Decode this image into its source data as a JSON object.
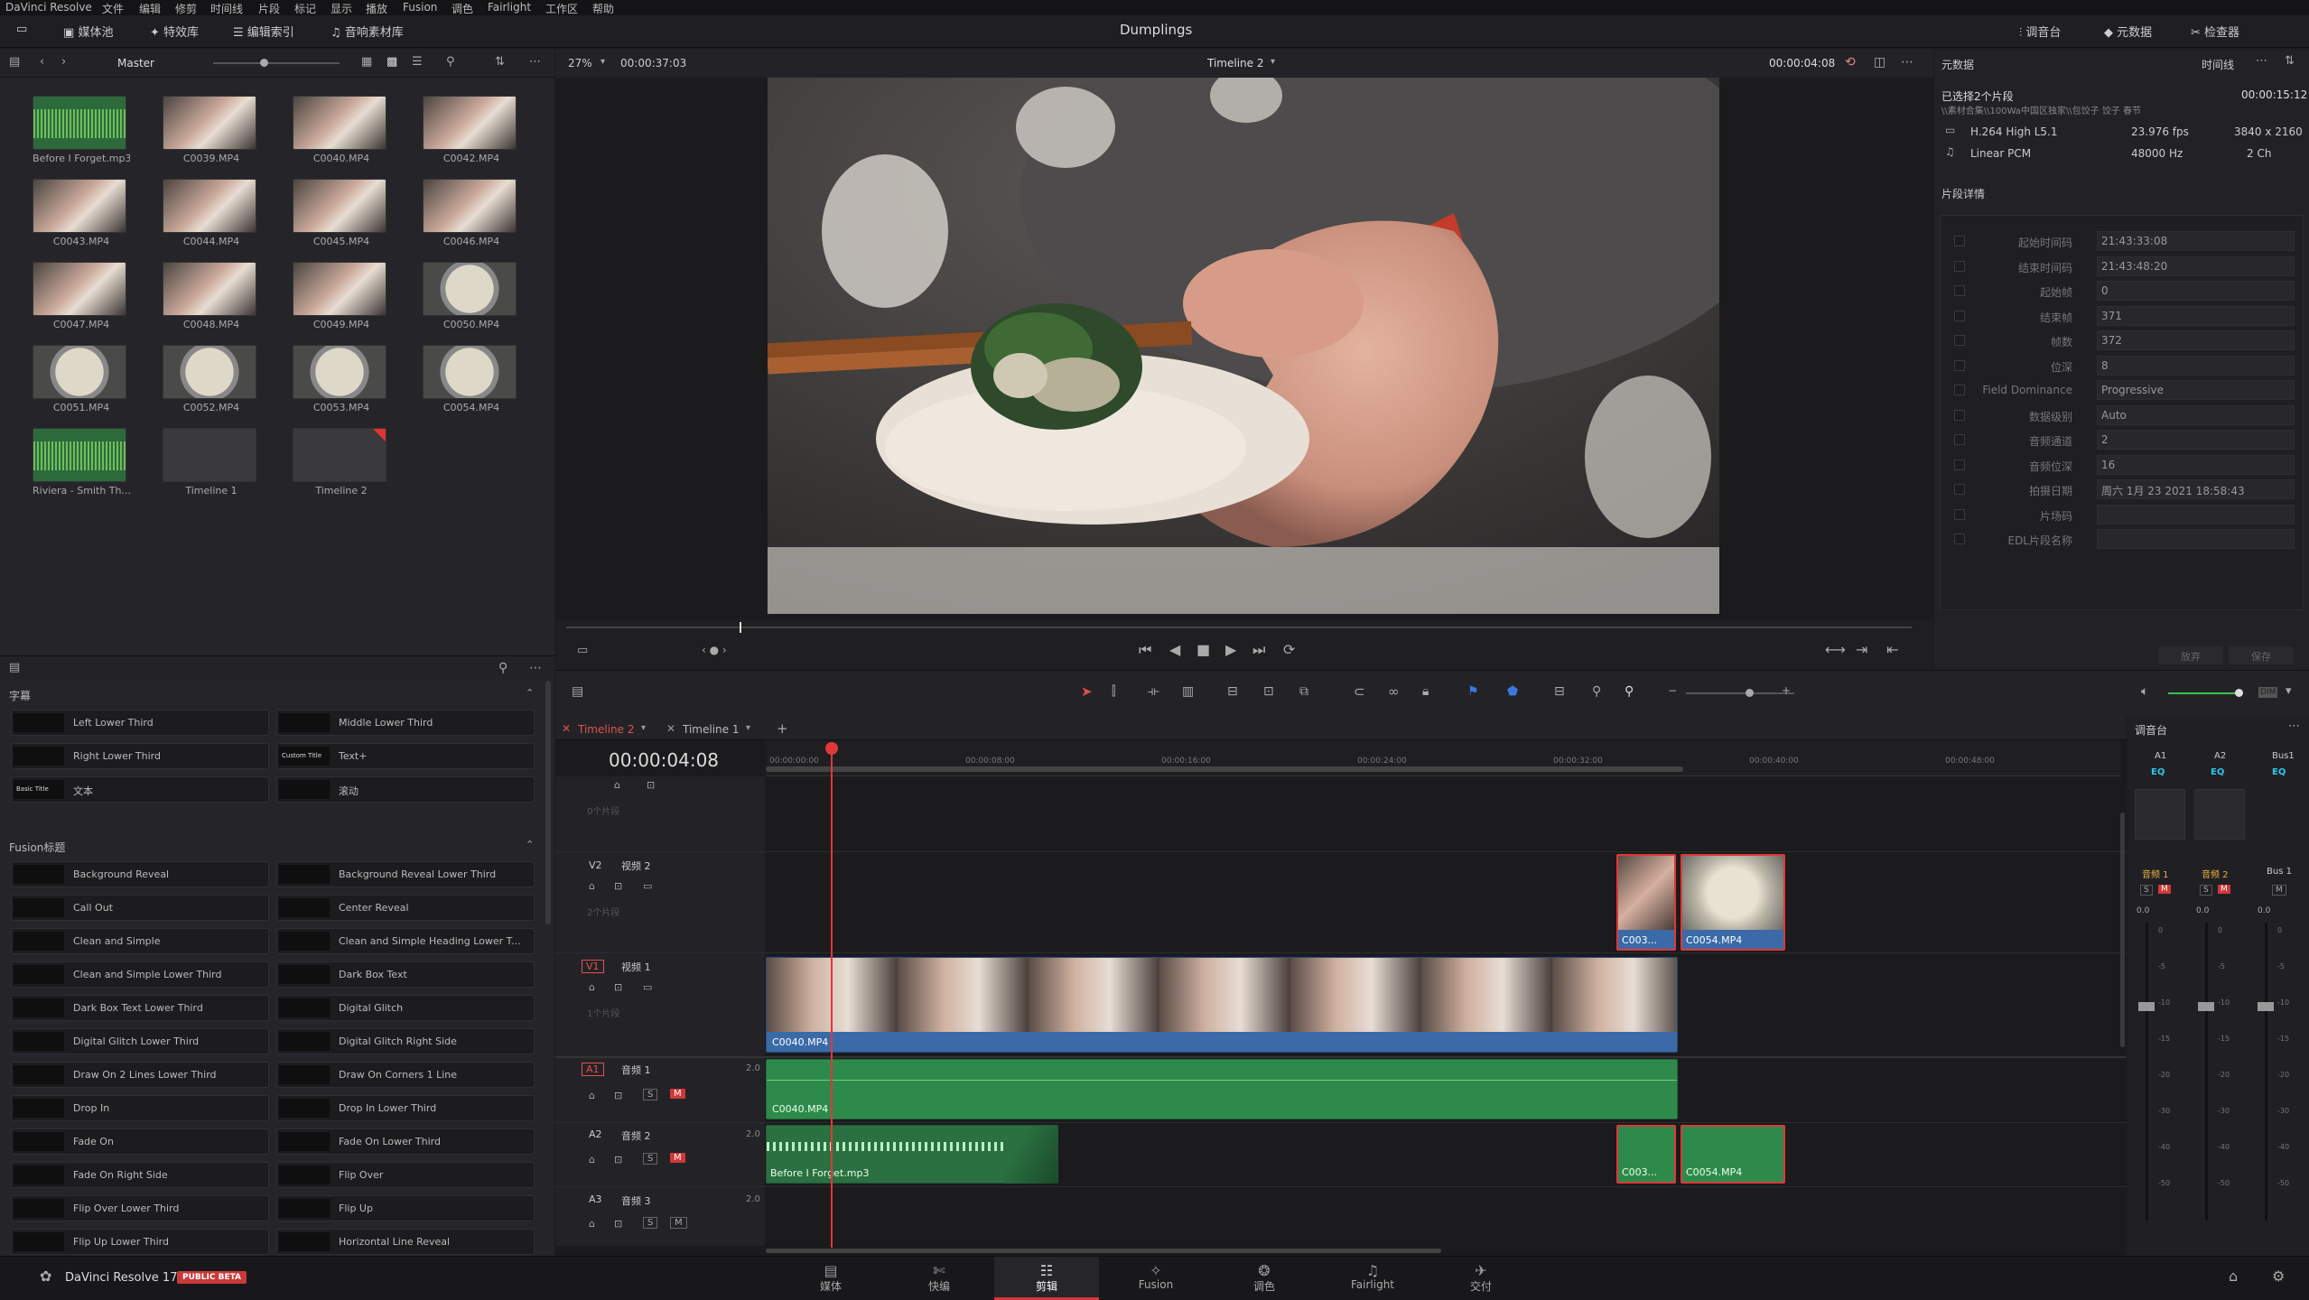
{
  "menubar": {
    "items": [
      "DaVinci Resolve",
      "文件",
      "编辑",
      "修剪",
      "时间线",
      "片段",
      "标记",
      "显示",
      "播放",
      "Fusion",
      "调色",
      "Fairlight",
      "工作区",
      "帮助"
    ]
  },
  "topbar": {
    "media_pool": "媒体池",
    "effects": "特效库",
    "edit_index": "编辑索引",
    "sound_library": "音响素材库",
    "project_title": "Dumplings",
    "mixer": "调音台",
    "metadata": "元数据",
    "inspector": "检查器"
  },
  "media_pool": {
    "bin": "Master",
    "clips": [
      {
        "name": "Before I Forget.mp3",
        "kind": "audio"
      },
      {
        "name": "C0039.MP4",
        "kind": "hand"
      },
      {
        "name": "C0040.MP4",
        "kind": "hand"
      },
      {
        "name": "C0042.MP4",
        "kind": "hand"
      },
      {
        "name": "C0043.MP4",
        "kind": "hand"
      },
      {
        "name": "C0044.MP4",
        "kind": "hand"
      },
      {
        "name": "C0045.MP4",
        "kind": "hand"
      },
      {
        "name": "C0046.MP4",
        "kind": "hand"
      },
      {
        "name": "C0047.MP4",
        "kind": "hand"
      },
      {
        "name": "C0048.MP4",
        "kind": "hand"
      },
      {
        "name": "C0049.MP4",
        "kind": "hand"
      },
      {
        "name": "C0050.MP4",
        "kind": "plate"
      },
      {
        "name": "C0051.MP4",
        "kind": "plate"
      },
      {
        "name": "C0052.MP4",
        "kind": "plate"
      },
      {
        "name": "C0053.MP4",
        "kind": "plate"
      },
      {
        "name": "C0054.MP4",
        "kind": "plate"
      },
      {
        "name": "Riviera - Smith Th...",
        "kind": "audio"
      },
      {
        "name": "Timeline 1",
        "kind": "tl"
      },
      {
        "name": "Timeline 2",
        "kind": "tl"
      }
    ]
  },
  "effects": {
    "subtitles_header": "字幕",
    "subtitles": [
      "Left Lower Third",
      "Middle Lower Third",
      "Right Lower Third",
      "Text+",
      "文本",
      "滚动"
    ],
    "subtitle_icons": [
      "",
      "",
      "",
      "Custom Title",
      "Basic Title",
      ""
    ],
    "fusion_header": "Fusion标题",
    "fusion": [
      "Background Reveal",
      "Background Reveal Lower Third",
      "Call Out",
      "Center Reveal",
      "Clean and Simple",
      "Clean and Simple Heading Lower T...",
      "Clean and Simple Lower Third",
      "Dark Box Text",
      "Dark Box Text Lower Third",
      "Digital Glitch",
      "Digital Glitch Lower Third",
      "Digital Glitch Right Side",
      "Draw On 2 Lines Lower Third",
      "Draw On Corners 1 Line",
      "Drop In",
      "Drop In Lower Third",
      "Fade On",
      "Fade On Lower Third",
      "Fade On Right Side",
      "Flip Over",
      "Flip Over Lower Third",
      "Flip Up",
      "Flip Up Lower Third",
      "Horizontal Line Reveal"
    ]
  },
  "viewer": {
    "zoom": "27%",
    "source_tc": "00:00:37:03",
    "timeline_name": "Timeline 2",
    "record_tc": "00:00:04:08",
    "playhead_fraction": 0.11
  },
  "metadata": {
    "title": "元数据",
    "right_label": "时间线",
    "selected": "已选择2个片段",
    "path": "\\\\素材合集\\\\100Wa中国区独家\\\\包饺子 饺子 春节",
    "duration": "00:00:15:12",
    "codec": "H.264 High L5.1",
    "fps": "23.976 fps",
    "resolution": "3840 x 2160",
    "audio_codec": "Linear PCM",
    "sample_rate": "48000 Hz",
    "channels": "2 Ch",
    "details_header": "片段详情",
    "fields": [
      {
        "label": "起始时间码",
        "value": "21:43:33:08"
      },
      {
        "label": "结束时间码",
        "value": "21:43:48:20"
      },
      {
        "label": "起始帧",
        "value": "0"
      },
      {
        "label": "结束帧",
        "value": "371"
      },
      {
        "label": "帧数",
        "value": "372"
      },
      {
        "label": "位深",
        "value": "8"
      },
      {
        "label": "Field Dominance",
        "value": "Progressive"
      },
      {
        "label": "数据级别",
        "value": "Auto"
      },
      {
        "label": "音频通道",
        "value": "2"
      },
      {
        "label": "音频位深",
        "value": "16"
      },
      {
        "label": "拍摄日期",
        "value": "周六 1月 23 2021 18:58:43"
      },
      {
        "label": "片场码",
        "value": ""
      },
      {
        "label": "EDL片段名称",
        "value": ""
      }
    ],
    "cancel": "放弃",
    "save": "保存"
  },
  "timeline": {
    "tab_active": "Timeline 2",
    "tab_other": "Timeline 1",
    "timecode": "00:00:04:08",
    "ruler": [
      "00:00:00:00",
      "00:00:08:00",
      "00:00:16:00",
      "00:00:24:00",
      "00:00:32:00",
      "00:00:40:00",
      "00:00:48:00"
    ],
    "tracks": {
      "v3_count": "0个片段",
      "v2_label": "V2",
      "v2_name": "视频 2",
      "v2_count": "2个片段",
      "v1_label": "V1",
      "v1_name": "视频 1",
      "v1_count": "1个片段",
      "a1_label": "A1",
      "a1_name": "音频 1",
      "a1_level": "2.0",
      "a2_label": "A2",
      "a2_name": "音频 2",
      "a2_level": "2.0",
      "a3_label": "A3",
      "a3_name": "音频 3",
      "a3_level": "2.0",
      "solo": "S",
      "mute": "M"
    },
    "clips": {
      "v2a": "C003...",
      "v2b": "C0054.MP4",
      "v1": "C0040.MP4",
      "a1": "C0040.MP4",
      "a2": "Before I Forget.mp3",
      "a2b": "C003...",
      "a2c": "C0054.MP4"
    }
  },
  "mixer": {
    "title": "调音台",
    "channels": [
      "A1",
      "A2",
      "Bus1"
    ],
    "eq": "EQ",
    "strip_names": [
      "音频 1",
      "音频 2",
      "Bus 1"
    ],
    "level": "0.0",
    "scale": [
      "0",
      "-5",
      "-10",
      "-15",
      "-20",
      "-30",
      "-40",
      "-50"
    ]
  },
  "bottom": {
    "app": "DaVinci Resolve 17",
    "beta": "PUBLIC BETA",
    "pages": [
      "媒体",
      "快编",
      "剪辑",
      "Fusion",
      "调色",
      "Fairlight",
      "交付"
    ],
    "active_page": 2
  }
}
